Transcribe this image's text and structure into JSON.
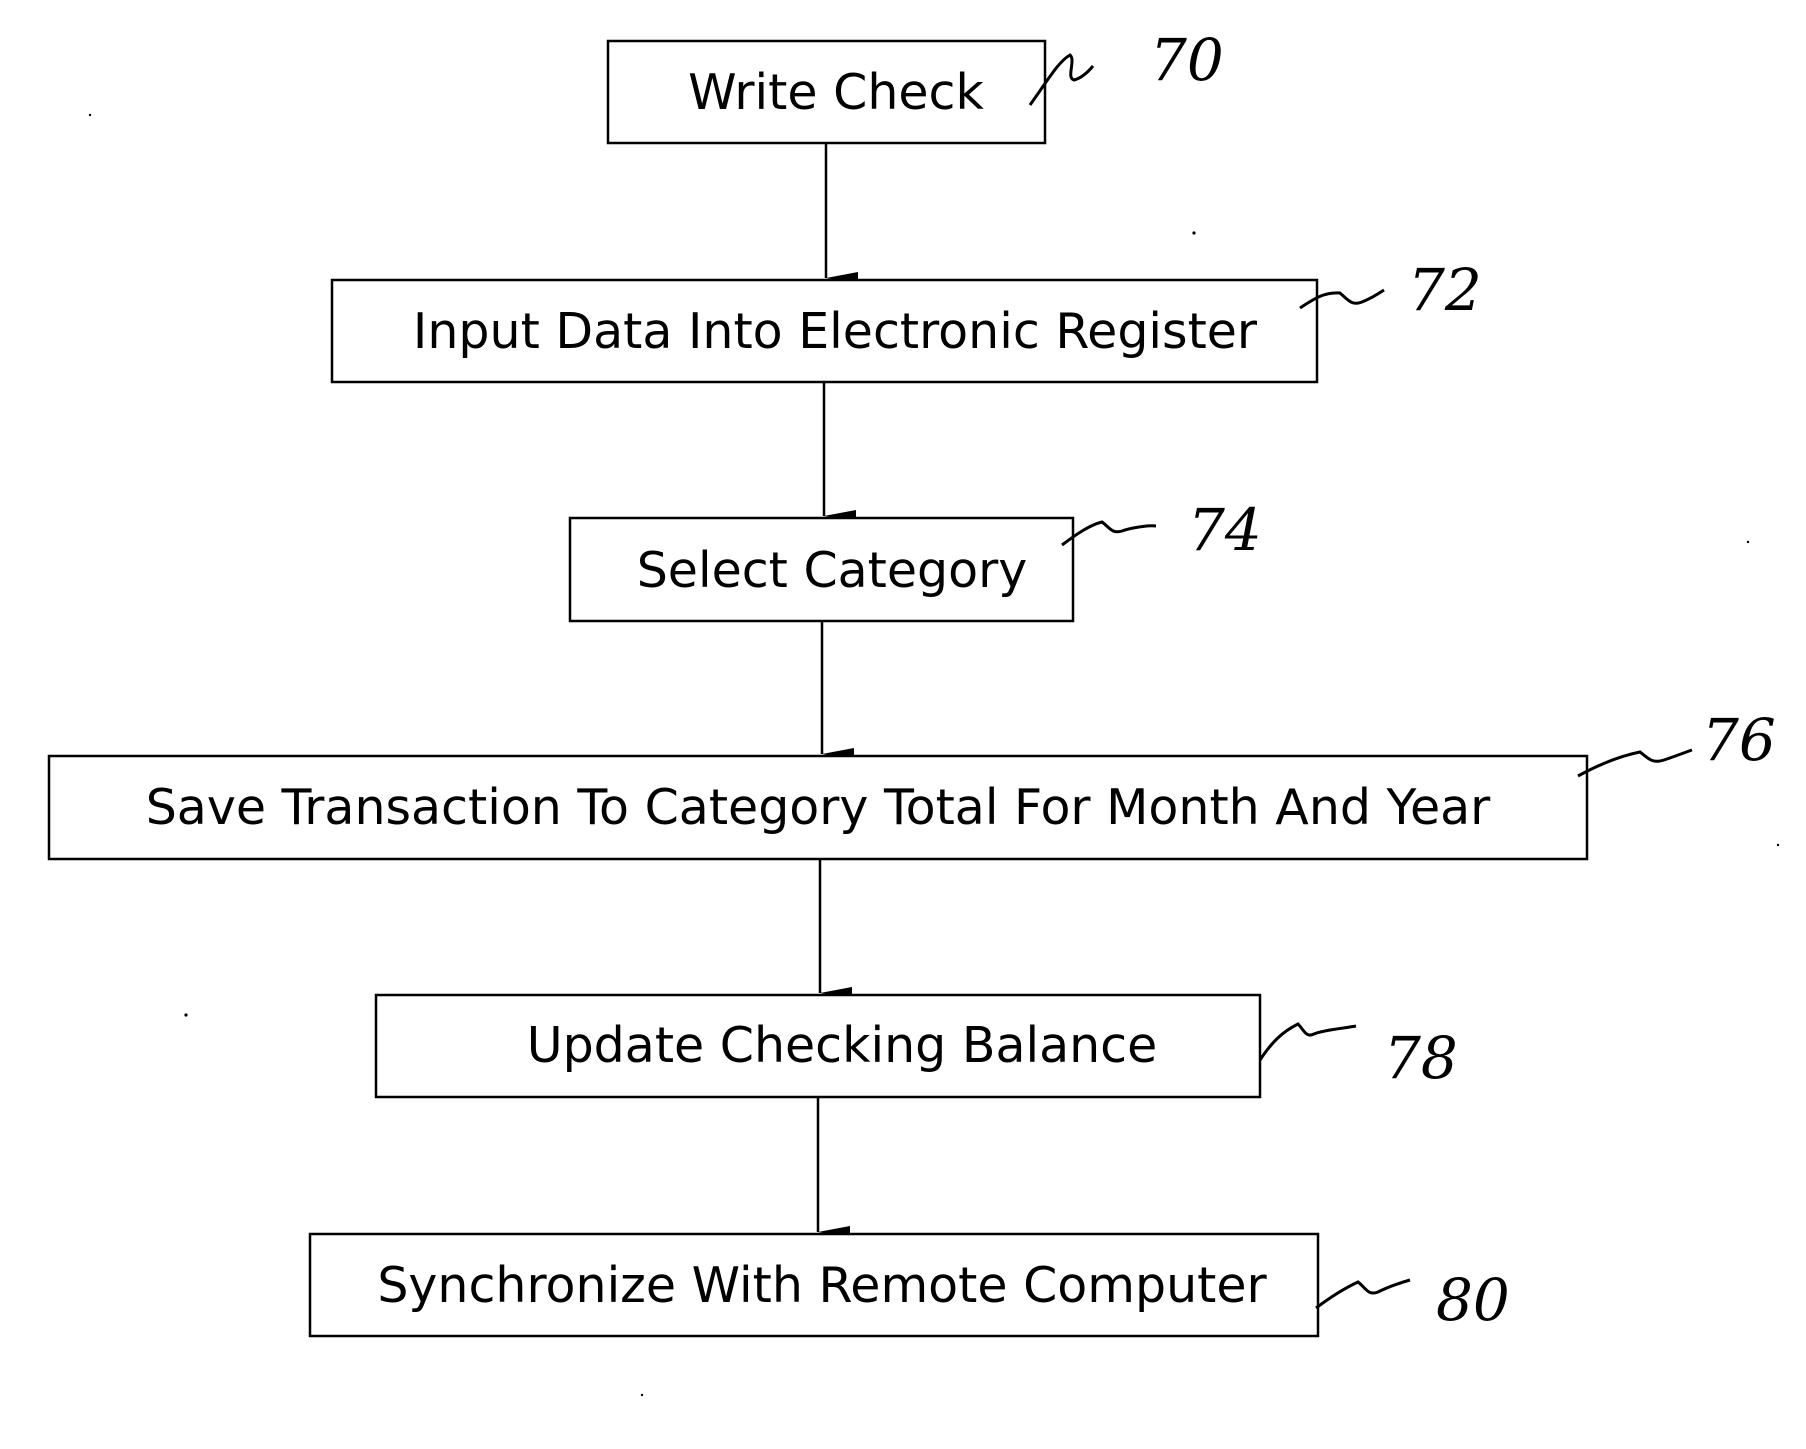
{
  "figure": {
    "type": "flowchart",
    "steps": [
      {
        "id": "70",
        "label": "Write Check"
      },
      {
        "id": "72",
        "label": "Input Data Into Electronic Register"
      },
      {
        "id": "74",
        "label": "Select Category"
      },
      {
        "id": "76",
        "label": "Save Transaction To Category Total For Month And Year"
      },
      {
        "id": "78",
        "label": "Update Checking Balance"
      },
      {
        "id": "80",
        "label": "Synchronize With Remote Computer"
      }
    ],
    "edges": [
      {
        "from": "70",
        "to": "72"
      },
      {
        "from": "72",
        "to": "74"
      },
      {
        "from": "74",
        "to": "76"
      },
      {
        "from": "76",
        "to": "78"
      },
      {
        "from": "78",
        "to": "80"
      }
    ]
  }
}
